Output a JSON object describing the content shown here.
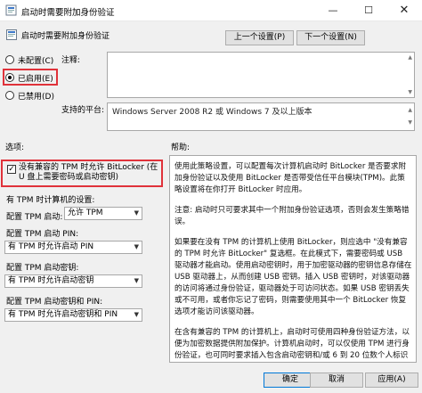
{
  "window": {
    "title": "启动时需要附加身份验证",
    "minimize": "—",
    "maximize": "☐",
    "close": "✕"
  },
  "header": {
    "policy_title": "启动时需要附加身份验证",
    "prev_button": "上一个设置(P)",
    "next_button": "下一个设置(N)"
  },
  "state": {
    "not_configured": "未配置(C)",
    "enabled": "已启用(E)",
    "disabled": "已禁用(D)",
    "selected": "enabled"
  },
  "comment": {
    "label": "注释:",
    "value": ""
  },
  "platform": {
    "label": "支持的平台:",
    "value": "Windows Server 2008 R2 或 Windows 7 及以上版本"
  },
  "options": {
    "section_label": "选项:",
    "allow_no_tpm_checkbox": "没有兼容的 TPM 时允许 BitLocker (在 U 盘上需要密码或启动密钥)",
    "allow_no_tpm_checked": true,
    "tpm_computer_settings": "有 TPM 时计算机的设置:",
    "tpm_startup_label": "配置 TPM 启动:",
    "tpm_startup_value": "允许 TPM",
    "tpm_pin_label": "配置 TPM 启动 PIN:",
    "tpm_pin_value": "有 TPM 时允许启动 PIN",
    "tpm_key_label": "配置 TPM 启动密钥:",
    "tpm_key_value": "有 TPM 时允许启动密钥",
    "tpm_key_pin_label": "配置 TPM 启动密钥和 PIN:",
    "tpm_key_pin_value": "有 TPM 时允许启动密钥和 PIN"
  },
  "help": {
    "section_label": "帮助:",
    "paragraphs": [
      "使用此策略设置，可以配置每次计算机启动时 BitLocker 是否要求附加身份验证以及使用 BitLocker 是否带受信任平台模块(TPM)。此策略设置将在你打开 BitLocker 时应用。",
      "注意: 启动时只可要求其中一个附加身份验证选项，否则会发生策略错误。",
      "如果要在没有 TPM 的计算机上使用 BitLocker，则应选中 \"没有兼容的 TPM 时允许 BitLocker\" 复选框。在此模式下，需要密码或 USB 驱动器才能启动。使用启动密钥时，用于加密驱动器的密钥信息存储在 USB 驱动器上，从而创建 USB 密钥。插入 USB 密钥时，对该驱动器的访问将通过身份验证，驱动器处于可访问状态。如果 USB 密钥丢失或不可用，或者你忘记了密码，则需要使用其中一个 BitLocker 恢复选项才能访问该驱动器。",
      "在含有兼容的 TPM 的计算机上，启动时可使用四种身份验证方法，以便为加密数据提供附加保护。计算机启动时，可以仅使用 TPM 进行身份验证，也可同时要求插入包含启动密钥和/或 6 到 20 位数个人标识号(PIN)的 U 盘。"
    ]
  },
  "footer": {
    "ok": "确定",
    "cancel": "取消",
    "apply": "应用(A)"
  },
  "colors": {
    "highlight": "#e0323a",
    "window_bg": "#f0f0f0"
  }
}
